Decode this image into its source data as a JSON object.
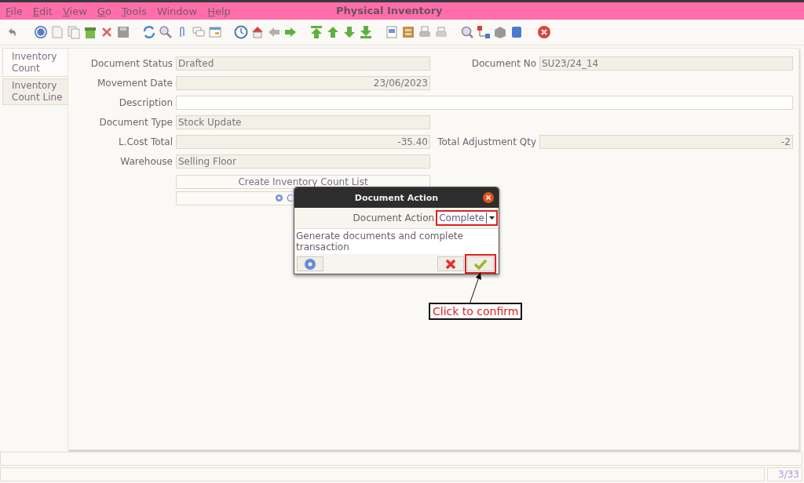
{
  "window": {
    "title": "Physical Inventory"
  },
  "menu": [
    {
      "label": "File",
      "mnemonic": true
    },
    {
      "label": "Edit",
      "mnemonic": true
    },
    {
      "label": "View",
      "mnemonic": true
    },
    {
      "label": "Go",
      "mnemonic": true
    },
    {
      "label": "Tools",
      "mnemonic": true
    },
    {
      "label": "Window",
      "mnemonic": false
    },
    {
      "label": "Help",
      "mnemonic": true
    }
  ],
  "tabs": [
    {
      "label": "Inventory Count",
      "selected": true
    },
    {
      "label": "Inventory Count Line",
      "selected": false
    }
  ],
  "form": {
    "rows": [
      {
        "fields": [
          {
            "label": "Document Status",
            "value": "Drafted",
            "kind": "text",
            "readonly": true
          },
          {
            "label": "Document No",
            "value": "SU23/24_14",
            "kind": "text",
            "readonly": true
          }
        ]
      },
      {
        "fields": [
          {
            "label": "Movement Date",
            "value": "23/06/2023",
            "kind": "number",
            "readonly": true
          }
        ]
      },
      {
        "fields": [
          {
            "label": "Description",
            "kind": "wide",
            "readonly": false
          }
        ]
      },
      {
        "fields": [
          {
            "label": "Document Type",
            "value": "Stock Update",
            "kind": "text",
            "readonly": true
          }
        ]
      },
      {
        "fields": [
          {
            "label": "L.Cost Total",
            "value": "-35.40",
            "kind": "number",
            "readonly": true
          },
          {
            "label": "Total Adjustment Qty",
            "value": "-2",
            "kind": "number",
            "readonly": true
          }
        ]
      },
      {
        "fields": [
          {
            "label": "Warehouse",
            "value": "Selling Floor",
            "kind": "text",
            "readonly": true
          }
        ]
      }
    ],
    "buttons": [
      {
        "label": "Create Inventory Count List",
        "kind": "plain"
      },
      {
        "label": "C",
        "kind": "process"
      }
    ]
  },
  "dialog": {
    "title": "Document Action",
    "field": {
      "label": "Document Action",
      "value": "Complete"
    },
    "description": "Generate documents and complete transaction"
  },
  "annotation": {
    "text": "Click to confirm"
  },
  "status_bar": {
    "page": "3/33"
  }
}
